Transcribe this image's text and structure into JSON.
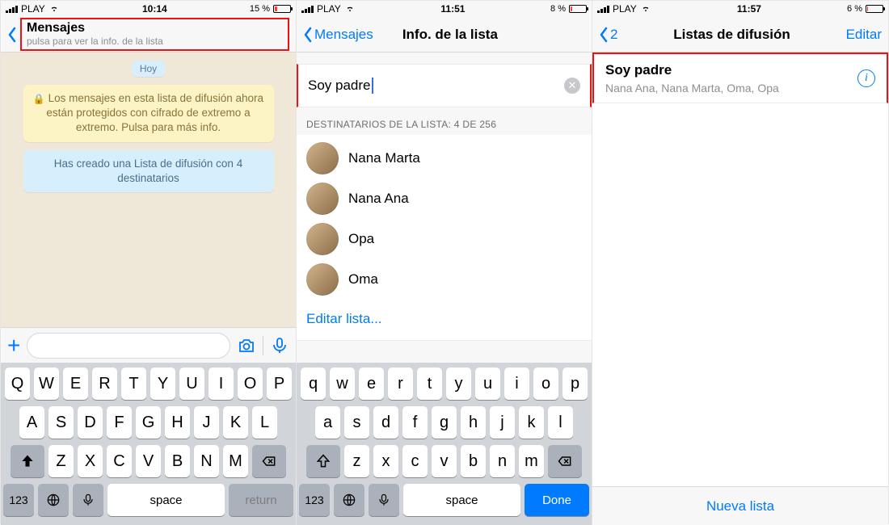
{
  "screens": [
    {
      "status": {
        "carrier": "PLAY",
        "time": "10:14",
        "battery_pct": "15 %",
        "battery_fill": "15%"
      },
      "nav": {
        "title": "Mensajes",
        "subtitle": "pulsa para ver la info. de la lista"
      },
      "chat": {
        "day_pill": "Hoy",
        "encryption_notice": "Los mensajes en esta lista de difusión ahora están protegidos con cifrado de extremo a extremo. Pulsa para más info.",
        "broadcast_created": "Has creado una Lista de difusión con 4 destinatarios"
      },
      "keyboard": {
        "case": "upper",
        "rows": [
          [
            "Q",
            "W",
            "E",
            "R",
            "T",
            "Y",
            "U",
            "I",
            "O",
            "P"
          ],
          [
            "A",
            "S",
            "D",
            "F",
            "G",
            "H",
            "J",
            "K",
            "L"
          ],
          [
            "Z",
            "X",
            "C",
            "V",
            "B",
            "N",
            "M"
          ]
        ],
        "numbers_key": "123",
        "space_key": "space",
        "return_key": "return"
      }
    },
    {
      "status": {
        "carrier": "PLAY",
        "time": "11:51",
        "battery_pct": "8 %",
        "battery_fill": "8%"
      },
      "nav": {
        "back": "Mensajes",
        "title": "Info. de la lista"
      },
      "name_field": "Soy padre",
      "recipients_header": "DESTINATARIOS DE LA LISTA: 4 DE  256",
      "contacts": [
        "Nana Marta",
        "Nana Ana",
        "Opa",
        "Oma"
      ],
      "edit_list": "Editar lista...",
      "keyboard": {
        "case": "lower",
        "rows": [
          [
            "q",
            "w",
            "e",
            "r",
            "t",
            "y",
            "u",
            "i",
            "o",
            "p"
          ],
          [
            "a",
            "s",
            "d",
            "f",
            "g",
            "h",
            "j",
            "k",
            "l"
          ],
          [
            "z",
            "x",
            "c",
            "v",
            "b",
            "n",
            "m"
          ]
        ],
        "numbers_key": "123",
        "space_key": "space",
        "done_key": "Done"
      }
    },
    {
      "status": {
        "carrier": "PLAY",
        "time": "11:57",
        "battery_pct": "6 %",
        "battery_fill": "6%"
      },
      "nav": {
        "back": "2",
        "title": "Listas de difusión",
        "edit": "Editar"
      },
      "list": {
        "name": "Soy padre",
        "recipients": "Nana Ana, Nana Marta, Oma, Opa"
      },
      "footer": {
        "new_list": "Nueva lista"
      }
    }
  ]
}
